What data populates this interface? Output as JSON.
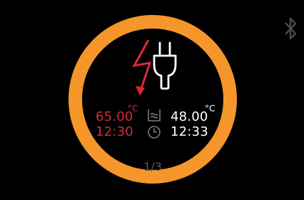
{
  "status": {
    "target_temperature": "65.00",
    "target_time": "12:30",
    "current_temperature": "48.00",
    "current_time": "12:33",
    "unit": "°C",
    "page_indicator": "1/3"
  },
  "icons": {
    "bluetooth": "bluetooth-icon",
    "power": "plug-with-lightning-icon",
    "water_bath": "water-bath-icon",
    "clock": "clock-icon"
  },
  "colors": {
    "ring": "#f5962a",
    "target": "#d8283c",
    "current": "#ffffff",
    "page_indicator": "#5a5a5a"
  }
}
